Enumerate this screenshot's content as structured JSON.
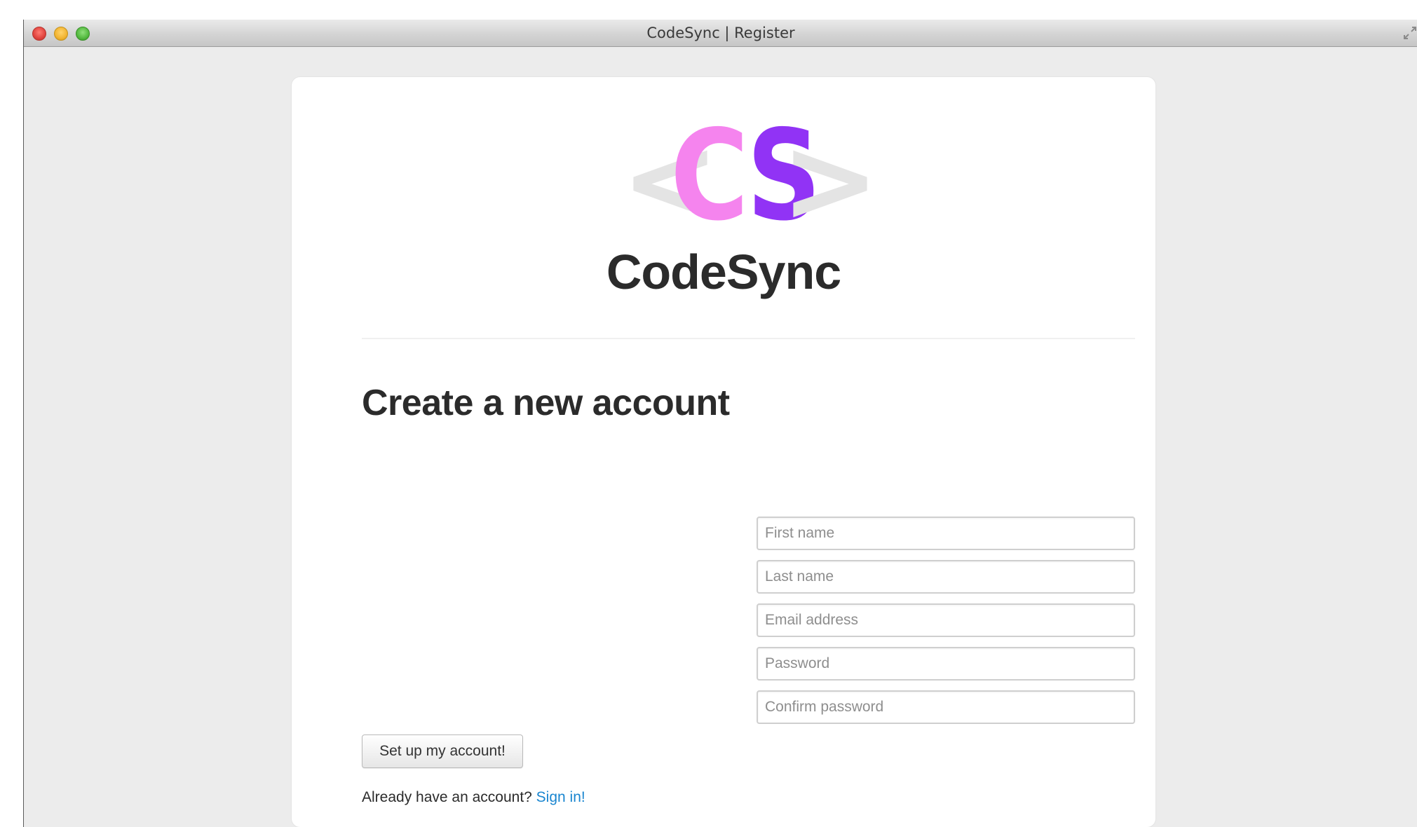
{
  "window": {
    "title": "CodeSync | Register",
    "traffic_lights": [
      "close",
      "minimize",
      "zoom"
    ]
  },
  "logo": {
    "left_bracket": "<",
    "letter_c": "C",
    "letter_s": "S",
    "right_bracket": ">",
    "colors": {
      "bracket": "#e4e4e4",
      "c": "#f584ee",
      "s": "#9133f5"
    }
  },
  "brand": {
    "name": "CodeSync"
  },
  "form": {
    "heading": "Create a new account",
    "fields": [
      {
        "name": "first-name",
        "placeholder": "First name",
        "value": ""
      },
      {
        "name": "last-name",
        "placeholder": "Last name",
        "value": ""
      },
      {
        "name": "email",
        "placeholder": "Email address",
        "value": ""
      },
      {
        "name": "password",
        "placeholder": "Password",
        "value": ""
      },
      {
        "name": "confirm-password",
        "placeholder": "Confirm password",
        "value": ""
      }
    ],
    "submit_label": "Set up my account!",
    "signin_prompt": "Already have an account? ",
    "signin_link": "Sign in!",
    "link_color": "#1a86d0"
  }
}
